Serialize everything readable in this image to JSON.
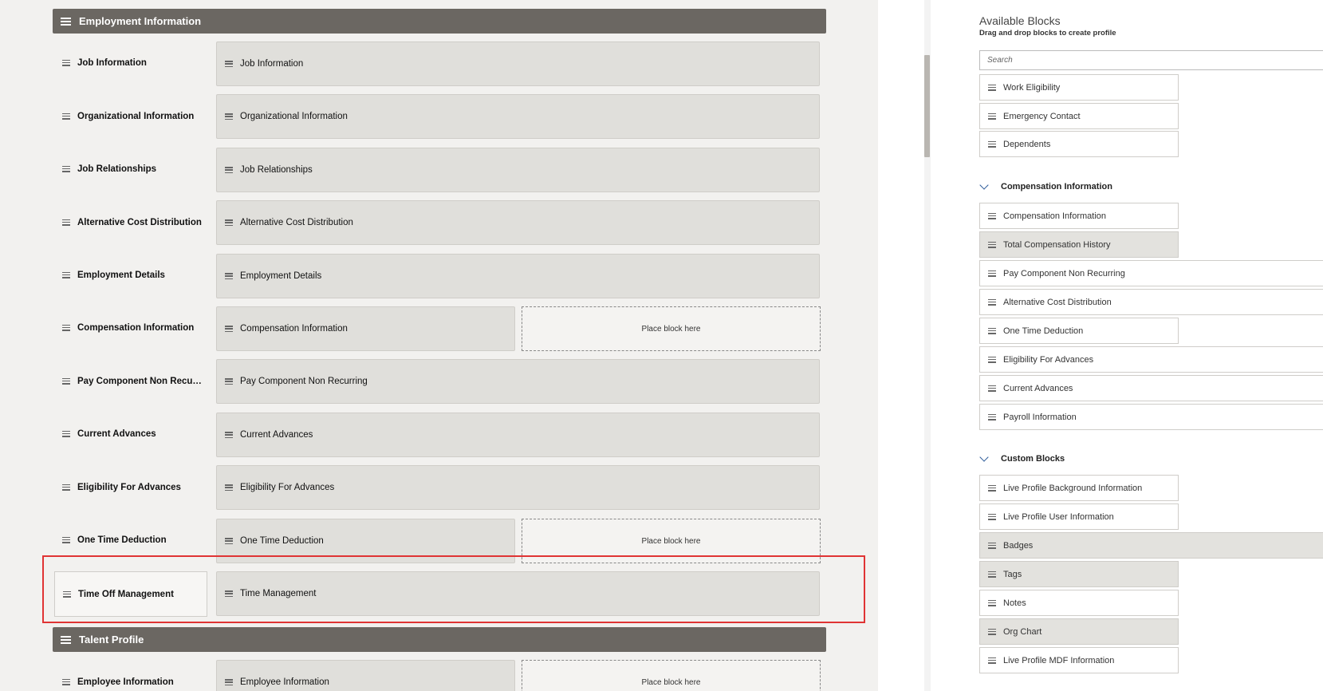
{
  "sections": [
    {
      "title": "Employment Information"
    },
    {
      "title": "Talent Profile"
    }
  ],
  "rows": [
    {
      "label": "Job Information",
      "block": "Job Information",
      "drop": null
    },
    {
      "label": "Organizational Information",
      "block": "Organizational Information",
      "drop": null
    },
    {
      "label": "Job Relationships",
      "block": "Job Relationships",
      "drop": null
    },
    {
      "label": "Alternative Cost Distribution",
      "block": "Alternative Cost Distribution",
      "drop": null
    },
    {
      "label": "Employment Details",
      "block": "Employment Details",
      "drop": null
    },
    {
      "label": "Compensation Information",
      "block": "Compensation Information",
      "drop": "Place block here"
    },
    {
      "label": "Pay Component Non Recurr...",
      "block": "Pay Component Non Recurring",
      "drop": null
    },
    {
      "label": "Current Advances",
      "block": "Current Advances",
      "drop": null
    },
    {
      "label": "Eligibility For Advances",
      "block": "Eligibility For Advances",
      "drop": null
    },
    {
      "label": "One Time Deduction",
      "block": "One Time Deduction",
      "drop": "Place block here"
    },
    {
      "label": "Time Off Management",
      "block": "Time Management",
      "drop": null
    },
    {
      "label": "Employee Information",
      "block": "Employee Information",
      "drop": "Place block here"
    }
  ],
  "available": {
    "title": "Available Blocks",
    "subtitle": "Drag and drop blocks to create profile",
    "search_placeholder": "Search",
    "top_items": [
      "Work Eligibility",
      "Emergency Contact",
      "Dependents"
    ],
    "groups": [
      {
        "name": "Compensation Information",
        "items": [
          "Compensation Information",
          "Total Compensation History",
          "Pay Component Non Recurring",
          "Alternative Cost Distribution",
          "One Time Deduction",
          "Eligibility For Advances",
          "Current Advances",
          "Payroll Information"
        ]
      },
      {
        "name": "Custom Blocks",
        "items": [
          "Live Profile Background Information",
          "Live Profile User Information",
          "Badges",
          "Tags",
          "Notes",
          "Org Chart",
          "Live Profile MDF Information"
        ]
      }
    ]
  },
  "colors": {
    "section_header": "#6b6762",
    "highlight": "#e03434",
    "chevron": "#2e5c9a"
  }
}
